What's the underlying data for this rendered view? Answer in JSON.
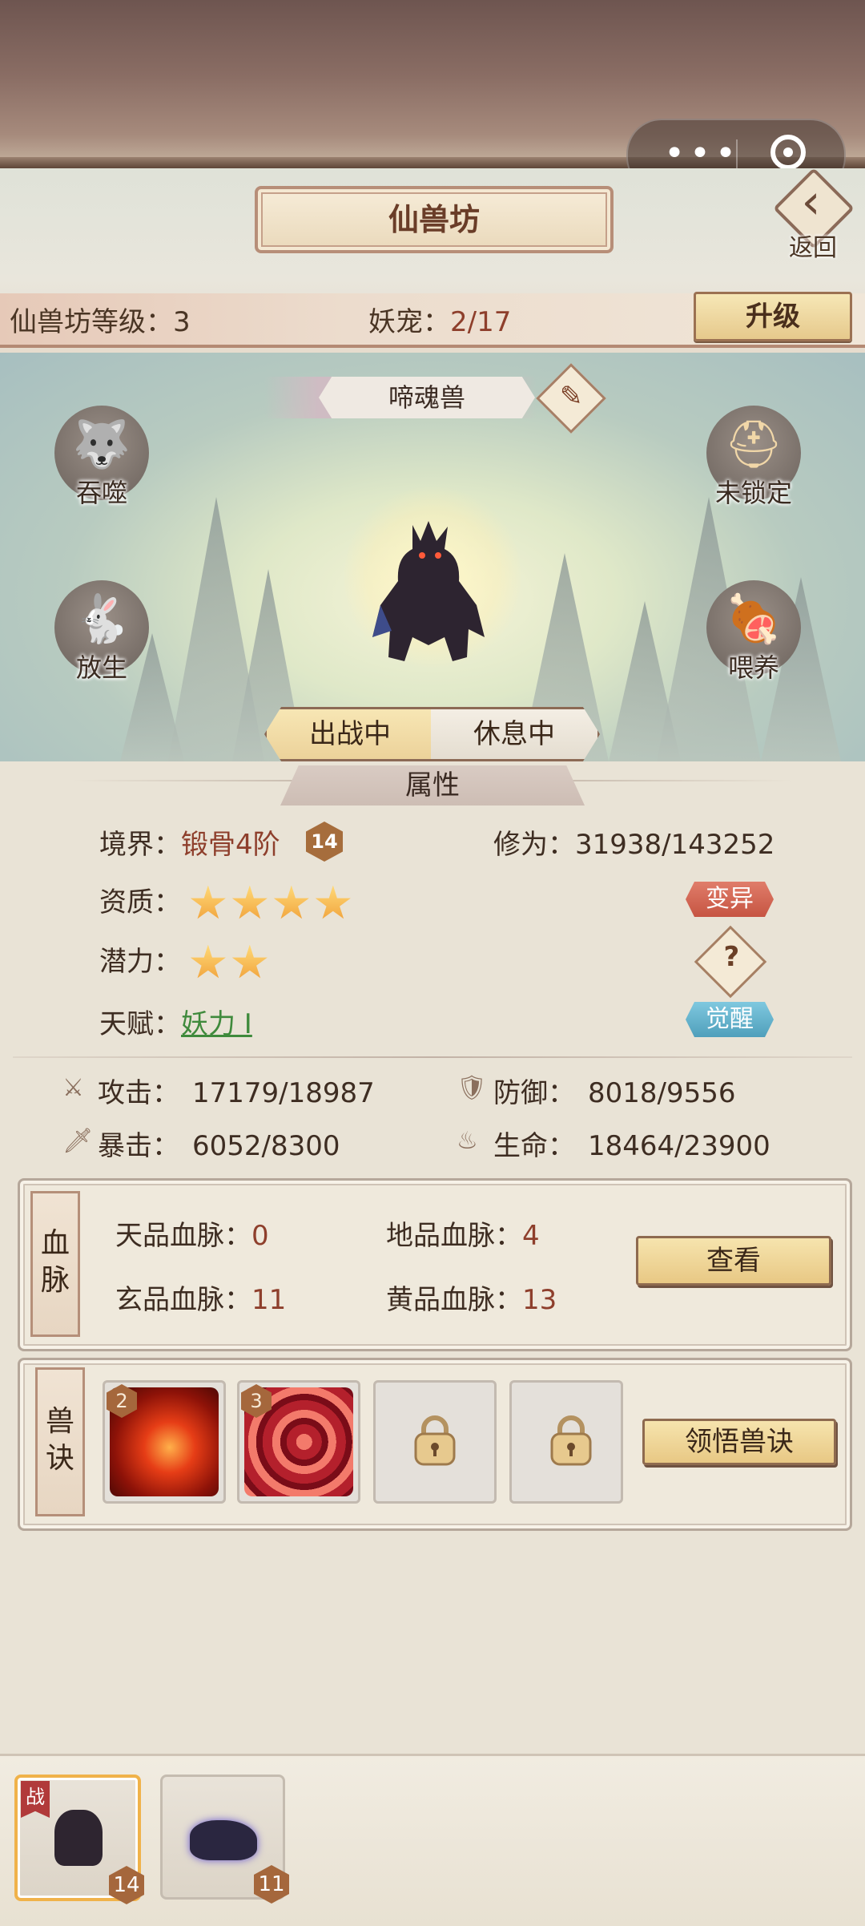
{
  "header": {
    "title": "仙兽坊",
    "back_label": "返回",
    "level_label": "仙兽坊等级：",
    "level_value": "3",
    "pet_label": "妖宠：",
    "pet_value": "2/17",
    "upgrade_label": "升级"
  },
  "pet": {
    "name": "啼魂兽",
    "actions": {
      "devour": "吞噬",
      "lock": "未锁定",
      "release": "放生",
      "feed": "喂养"
    },
    "status_tabs": {
      "battle": "出战中",
      "rest": "休息中"
    }
  },
  "attributes": {
    "section_title": "属性",
    "realm_label": "境界：",
    "realm_value": "锻骨4阶",
    "realm_level": "14",
    "cultivation_label": "修为：",
    "cultivation_value": "31938/143252",
    "aptitude_label": "资质：",
    "aptitude_stars": 4,
    "potential_label": "潜力：",
    "potential_stars": 2,
    "talent_label": "天赋：",
    "talent_value": "妖力 I",
    "mutate_label": "变异",
    "help_label": "?",
    "awaken_label": "觉醒",
    "attack_label": "攻击：",
    "attack_value": "17179/18987",
    "defense_label": "防御：",
    "defense_value": "8018/9556",
    "crit_label": "暴击：",
    "crit_value": "6052/8300",
    "hp_label": "生命：",
    "hp_value": "18464/23900"
  },
  "bloodline": {
    "tab": "血脉",
    "heaven_label": "天品血脉：",
    "heaven_value": "0",
    "earth_label": "地品血脉：",
    "earth_value": "4",
    "mystic_label": "玄品血脉：",
    "mystic_value": "11",
    "yellow_label": "黄品血脉：",
    "yellow_value": "13",
    "view_label": "查看"
  },
  "skills": {
    "tab": "兽诀",
    "slot1_level": "2",
    "slot2_level": "3",
    "learn_label": "领悟兽诀"
  },
  "tray": {
    "battle_tag": "战",
    "pet1_level": "14",
    "pet2_level": "11"
  },
  "colors": {
    "accent_red": "#8e3f2c",
    "talent_green": "#3f8a3c",
    "star": "#f5b23e"
  }
}
